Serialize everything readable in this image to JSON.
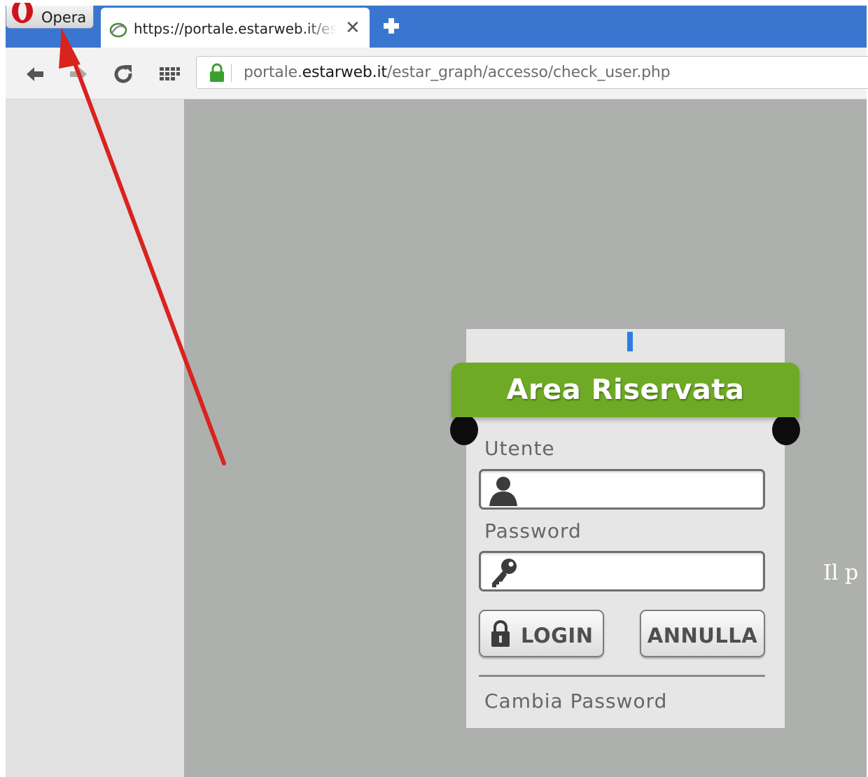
{
  "browser": {
    "menu_label": "Opera",
    "tab": {
      "title": "https://portale.estarweb.it/estar_graph/accesso/check_user.php",
      "close_glyph": "✕"
    },
    "new_tab_icon": "plus-icon",
    "nav_icons": [
      "back-arrow-icon",
      "forward-arrow-icon",
      "reload-icon",
      "speed-dial-icon"
    ],
    "address": {
      "prefix": "portale.",
      "domain": "estarweb.it",
      "path": "/estar_graph/accesso/check_user.php",
      "secure_icon": "lock-icon",
      "secure_color": "#3aa12f"
    },
    "accent_color": "#3a76d0"
  },
  "login": {
    "title": "Area Riservata",
    "title_color": "#6eaa25",
    "user_label": "Utente",
    "user_value": "",
    "user_icon": "user-icon",
    "password_label": "Password",
    "password_value": "",
    "password_icon": "key-icon",
    "login_button": "LOGIN",
    "login_icon": "padlock-icon",
    "cancel_button": "ANNULLA",
    "change_password_link": "Cambia Password"
  },
  "page": {
    "side_text": "Il p"
  },
  "annotation": {
    "color": "#d9231f",
    "icon": "red-arrow-annotation"
  }
}
